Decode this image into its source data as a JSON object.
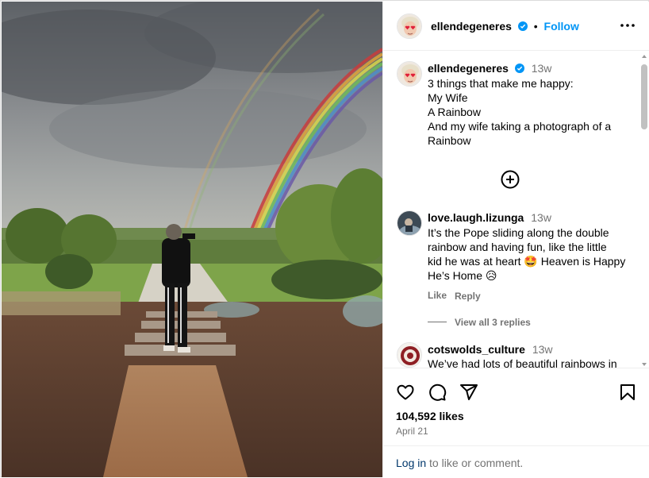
{
  "post": {
    "author": "ellendegeneres",
    "follow_label": "Follow",
    "dot": "•",
    "caption": {
      "username": "ellendegeneres",
      "time": "13w",
      "lines": [
        "3 things that make me happy:",
        "My Wife",
        "A Rainbow",
        "And my wife taking a photograph of a",
        "Rainbow"
      ]
    }
  },
  "comments": [
    {
      "username": "love.laugh.lizunga",
      "time": "13w",
      "lines": [
        "It’s the Pope sliding along the double",
        "rainbow and having fun, like the little",
        "kid he was at heart 🤩 Heaven is Happy",
        "He’s Home 😥"
      ],
      "like_label": "Like",
      "reply_label": "Reply",
      "view_replies": "View all 3 replies"
    },
    {
      "username": "cotswolds_culture",
      "time": "13w",
      "lines": [
        "We’ve had lots of beautiful rainbows in"
      ]
    }
  ],
  "footer": {
    "likes": "104,592 likes",
    "date": "April 21",
    "login_link": "Log in",
    "login_rest": " to like or comment."
  },
  "colors": {
    "accent": "#0095f6",
    "link": "#00376b",
    "muted": "#737373",
    "verified": "#0095f6"
  },
  "icons": [
    "more-icon",
    "add-comment-icon",
    "heart-icon",
    "comment-icon",
    "share-icon",
    "bookmark-icon",
    "verified-icon"
  ]
}
